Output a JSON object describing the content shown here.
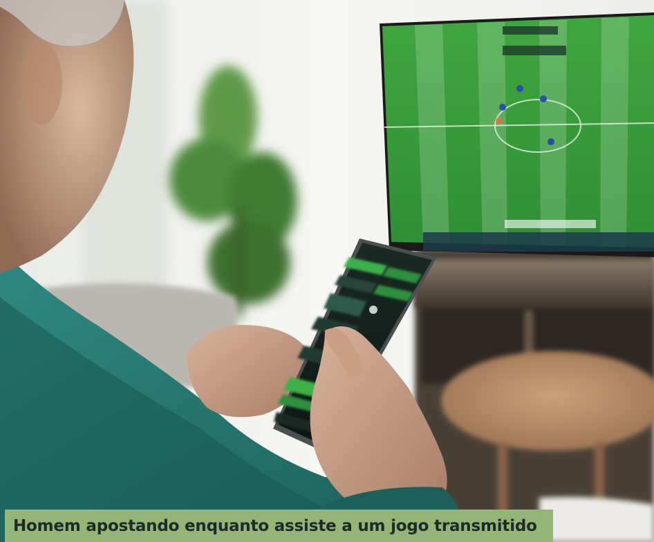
{
  "caption": {
    "text": "Homem apostando enquanto assiste a um jogo transmitido"
  },
  "colors": {
    "caption_background": "#93b577",
    "caption_text": "#1e2a26",
    "pitch_green": "#3a9a3c",
    "sweater_teal": "#2a7d77"
  },
  "photo": {
    "subject": "man-holding-phone",
    "tv_content": "football-match",
    "phone_content": "betting-app"
  }
}
